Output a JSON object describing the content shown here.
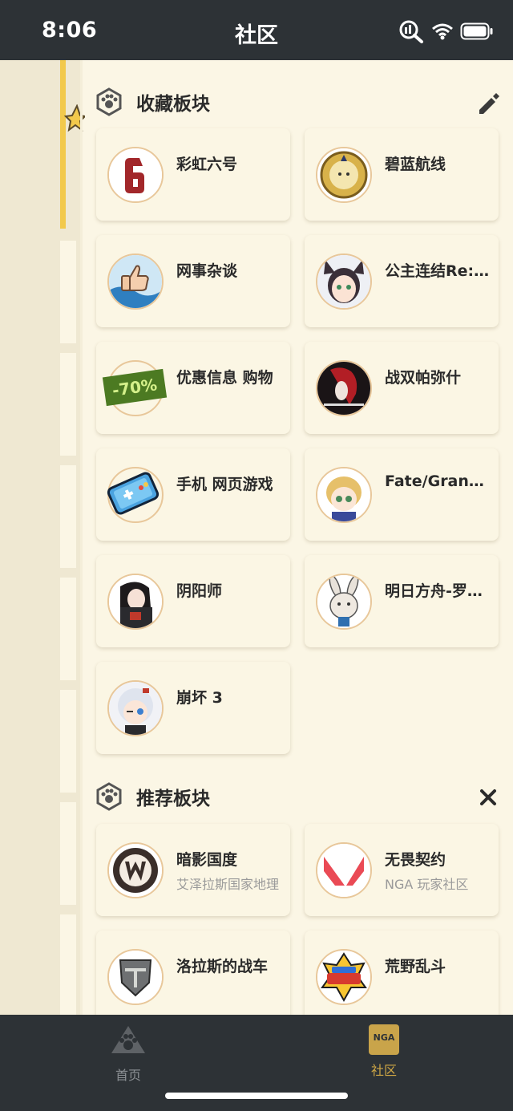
{
  "status_bar": {
    "time": "8:06",
    "title": "社区"
  },
  "favorites": {
    "title": "收藏板块",
    "items": [
      {
        "name": "彩虹六号"
      },
      {
        "name": "碧蓝航线"
      },
      {
        "name": "网事杂谈"
      },
      {
        "name": "公主连结Re:Dive"
      },
      {
        "name": "优惠信息 购物"
      },
      {
        "name": "战双帕弥什"
      },
      {
        "name": "手机 网页游戏"
      },
      {
        "name": "Fate/Grand Order"
      },
      {
        "name": "阴阳师"
      },
      {
        "name": "明日方舟-罗德岛"
      },
      {
        "name": "崩坏 3"
      }
    ],
    "badge_text": "-70%"
  },
  "recommended": {
    "title": "推荐板块",
    "items": [
      {
        "name": "暗影国度",
        "desc": "艾泽拉斯国家地理"
      },
      {
        "name": "无畏契约",
        "desc": "NGA 玩家社区"
      },
      {
        "name": "洛拉斯的战车"
      },
      {
        "name": "荒野乱斗"
      }
    ]
  },
  "tab_bar": {
    "tabs": [
      {
        "label": "首页",
        "active": false
      },
      {
        "label": "社区",
        "active": true
      }
    ],
    "nga_text": "NGA"
  },
  "colors": {
    "accent": "#c9a44a",
    "bar": "#2d3236",
    "background": "#fbf6e5"
  }
}
